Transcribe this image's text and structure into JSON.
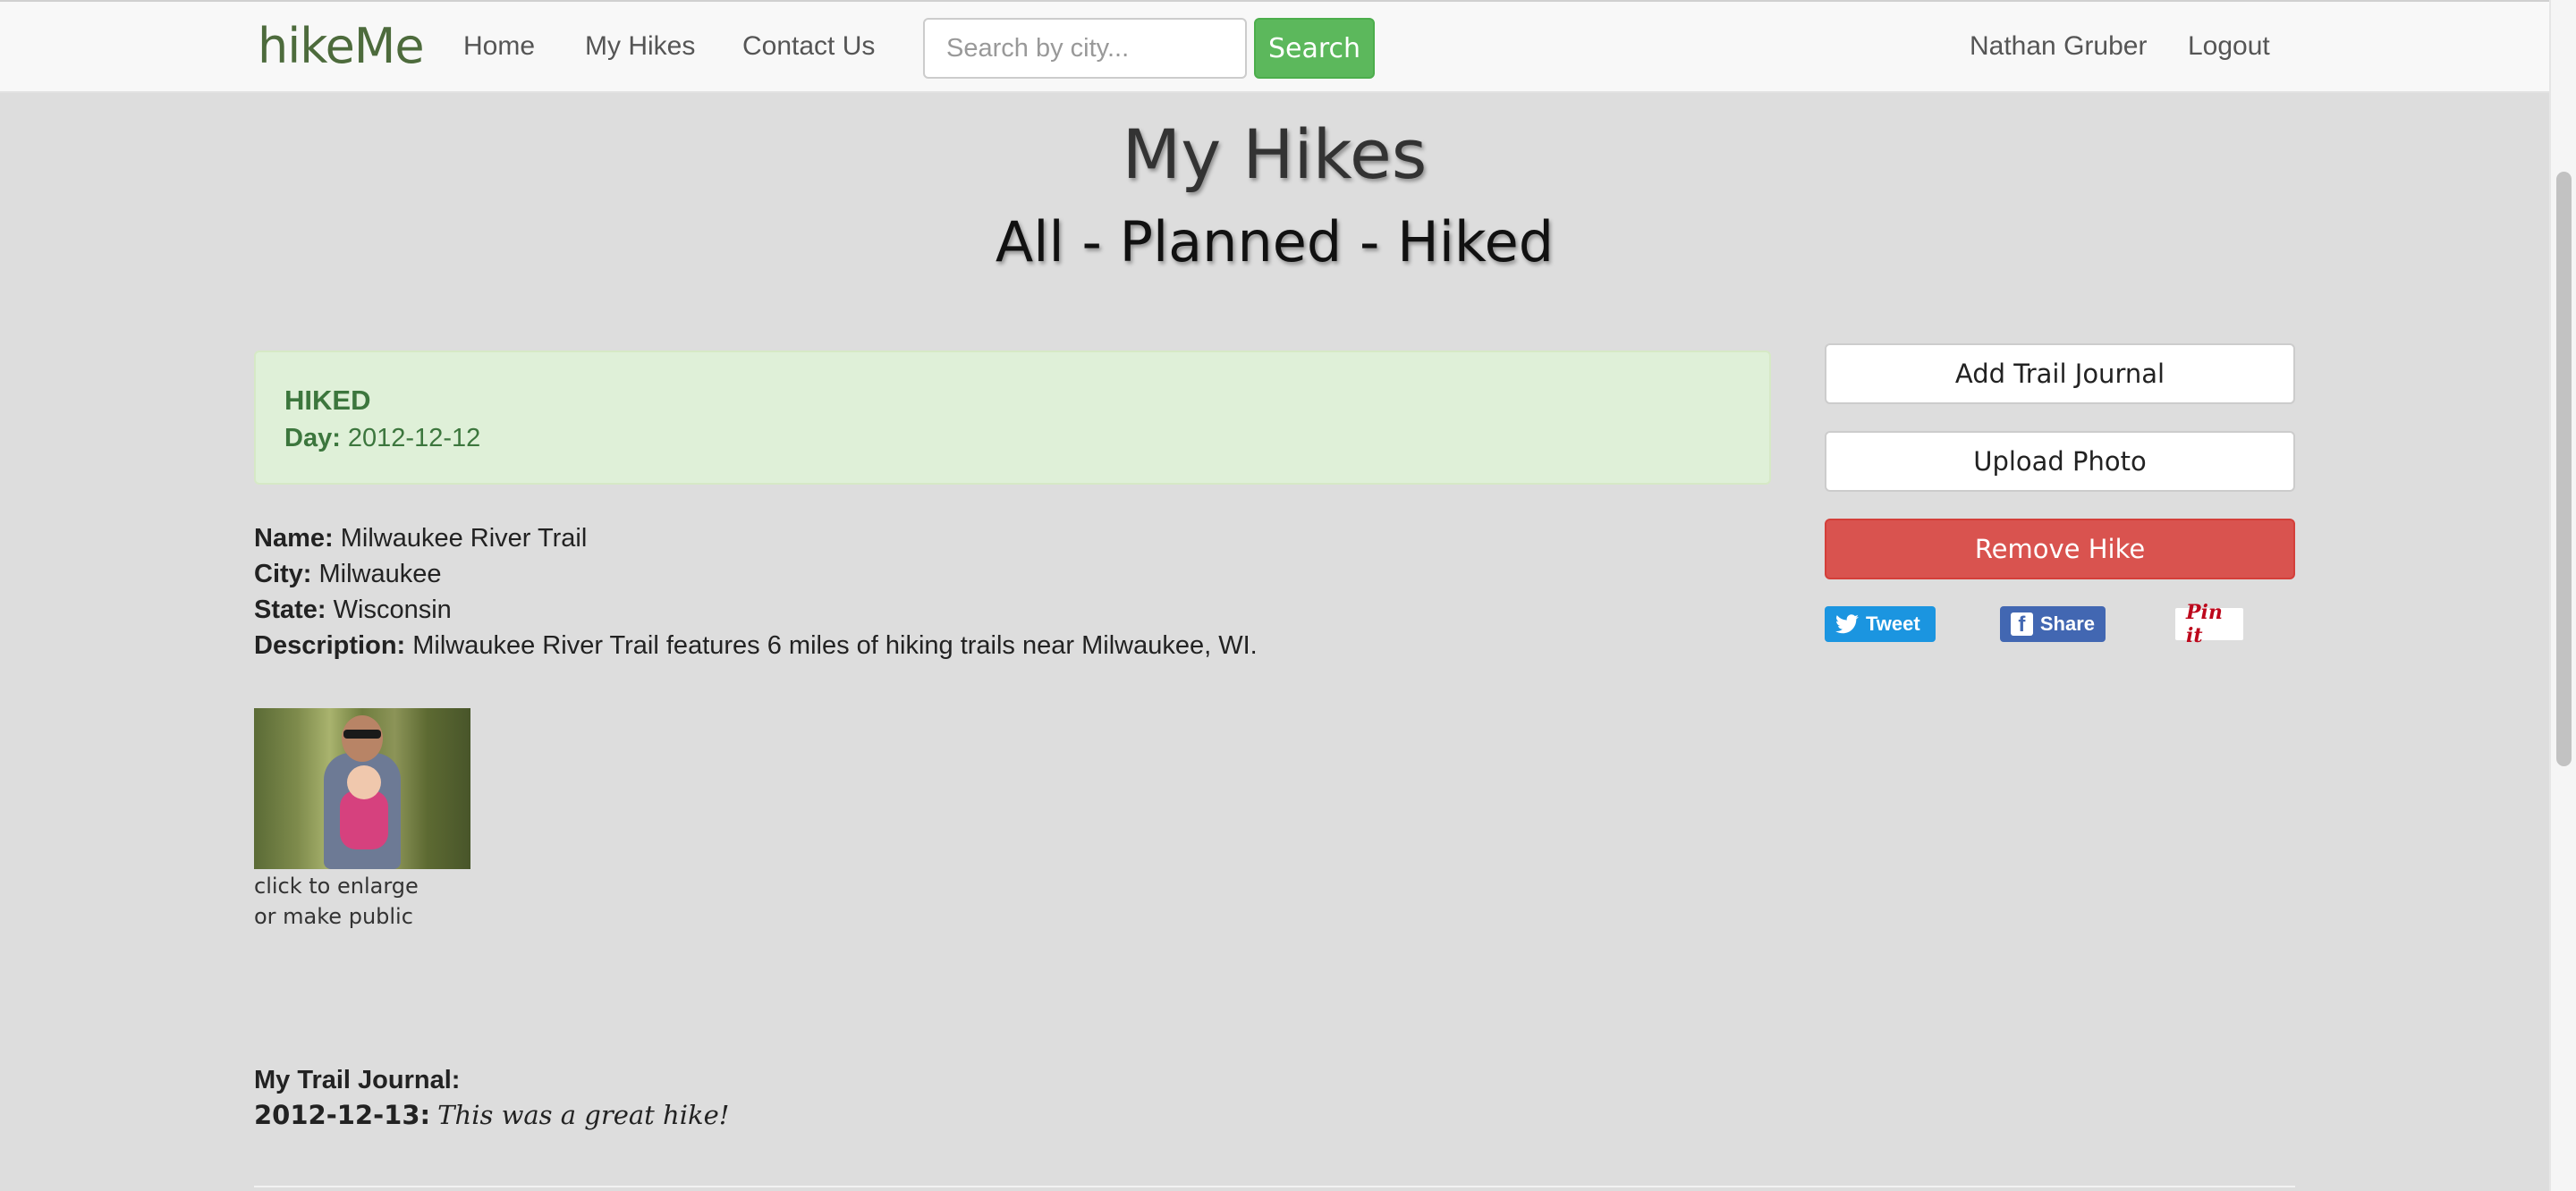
{
  "navbar": {
    "brand": "hikeMe",
    "links": [
      "Home",
      "My Hikes",
      "Contact Us"
    ],
    "search_placeholder": "Search by city...",
    "search_button": "Search",
    "user_name": "Nathan Gruber",
    "logout": "Logout"
  },
  "page": {
    "title": "My Hikes",
    "filters": {
      "all": "All",
      "planned": "Planned",
      "hiked": "Hiked",
      "separator": "-"
    }
  },
  "status": {
    "label": "HIKED",
    "day_label": "Day:",
    "day_value": "2012-12-12",
    "color": "#3c763d"
  },
  "hike": {
    "name_label": "Name:",
    "name": "Milwaukee River Trail",
    "city_label": "City:",
    "city": "Milwaukee",
    "state_label": "State:",
    "state": "Wisconsin",
    "description_label": "Description:",
    "description": "Milwaukee River Trail features 6 miles of hiking trails near Milwaukee, WI."
  },
  "photo": {
    "caption_line1": "click to enlarge",
    "caption_line2": "or make public"
  },
  "journal": {
    "title": "My Trail Journal:",
    "entries": [
      {
        "date": "2012-12-13:",
        "text": "This was a great hike!"
      }
    ]
  },
  "sidebar": {
    "add_journal": "Add Trail Journal",
    "upload_photo": "Upload Photo",
    "remove_hike": "Remove Hike",
    "tweet": "Tweet",
    "share": "Share",
    "pin": "Pin it",
    "danger_color": "#d9534f"
  }
}
